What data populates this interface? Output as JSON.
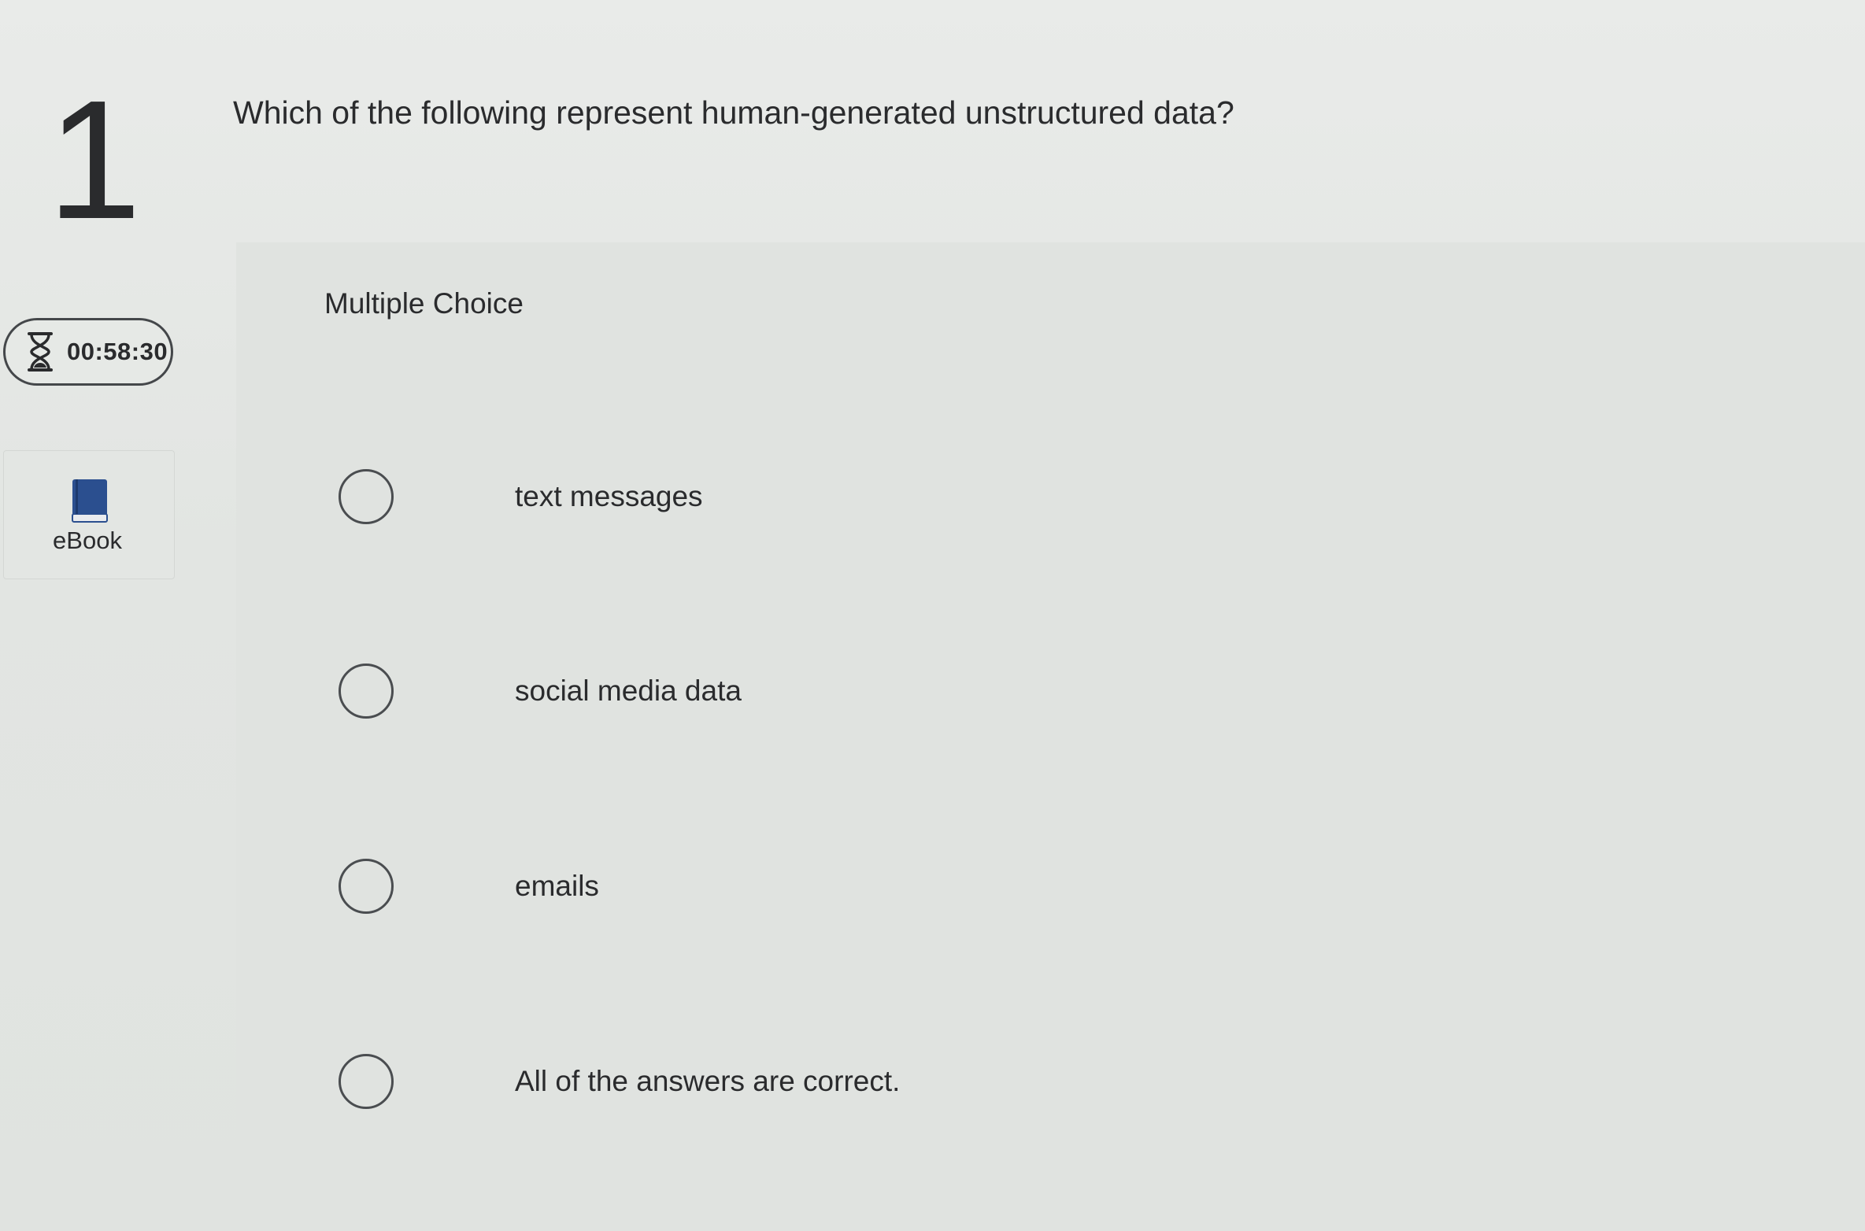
{
  "question": {
    "number": "1",
    "text": "Which of the following represent human-generated unstructured data?",
    "type_label": "Multiple Choice"
  },
  "timer": {
    "icon": "hourglass-icon",
    "value": "00:58:30"
  },
  "ebook": {
    "icon": "book-icon",
    "label": "eBook",
    "icon_color": "#2b4f8f"
  },
  "options": [
    {
      "label": "text messages",
      "selected": false
    },
    {
      "label": "social media data",
      "selected": false
    },
    {
      "label": "emails",
      "selected": false
    },
    {
      "label": "All of the answers are correct.",
      "selected": false
    }
  ]
}
